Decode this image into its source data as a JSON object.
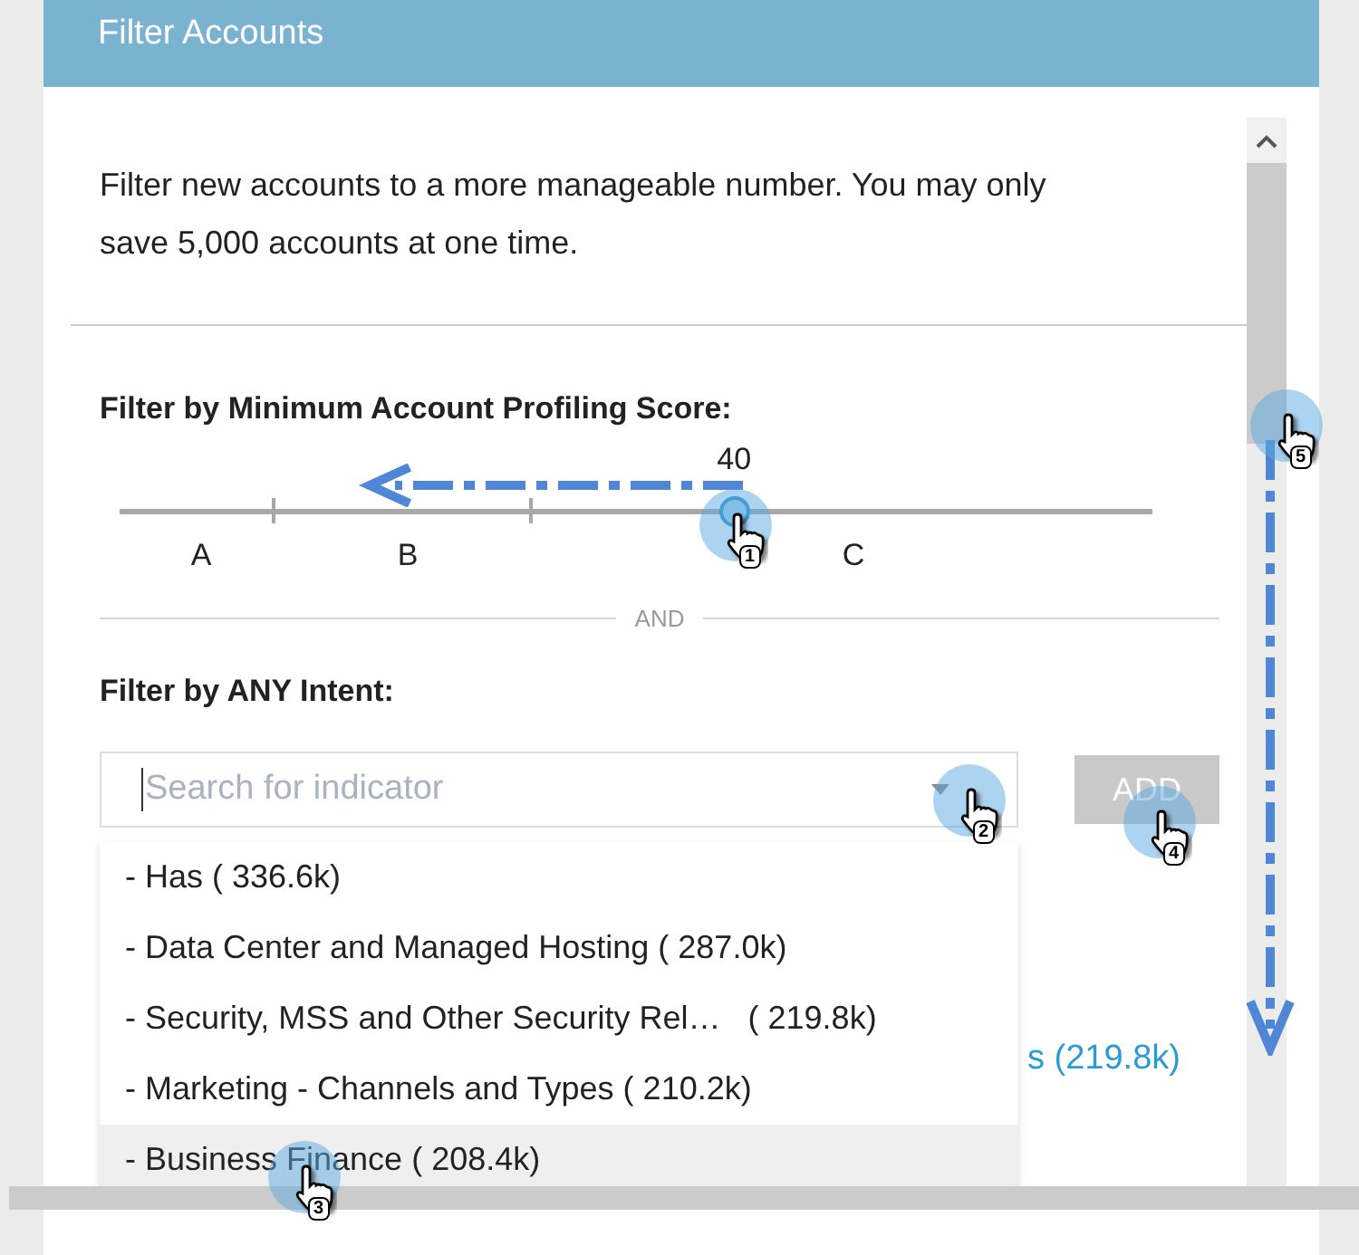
{
  "header": {
    "title": "Filter Accounts"
  },
  "intro": "Filter new accounts to a more manageable number. You may only save 5,000 accounts at one time.",
  "score_filter": {
    "heading": "Filter by Minimum Account Profiling Score:",
    "value": "40",
    "level": 0.595,
    "bands": [
      "A",
      "B",
      "C"
    ]
  },
  "separator": "AND",
  "intent_filter": {
    "heading": "Filter by ANY Intent:",
    "search": {
      "placeholder": "Search for indicator"
    },
    "add_button": {
      "label": "ADD",
      "disabled": true
    },
    "behind_text": "s (219.8k)",
    "dropdown": [
      {
        "label": "- Has ( 336.6k)",
        "selected": false
      },
      {
        "label": "- Data Center and Managed Hosting ( 287.0k)",
        "selected": false
      },
      {
        "label": "- Security, MSS and Other Security Rel…   ( 219.8k)",
        "selected": false
      },
      {
        "label": "- Marketing - Channels and Types ( 210.2k)",
        "selected": false
      },
      {
        "label": "- Business Finance ( 208.4k)",
        "selected": true
      }
    ]
  },
  "annotations": {
    "steps": [
      "1",
      "2",
      "3",
      "4",
      "5"
    ]
  }
}
